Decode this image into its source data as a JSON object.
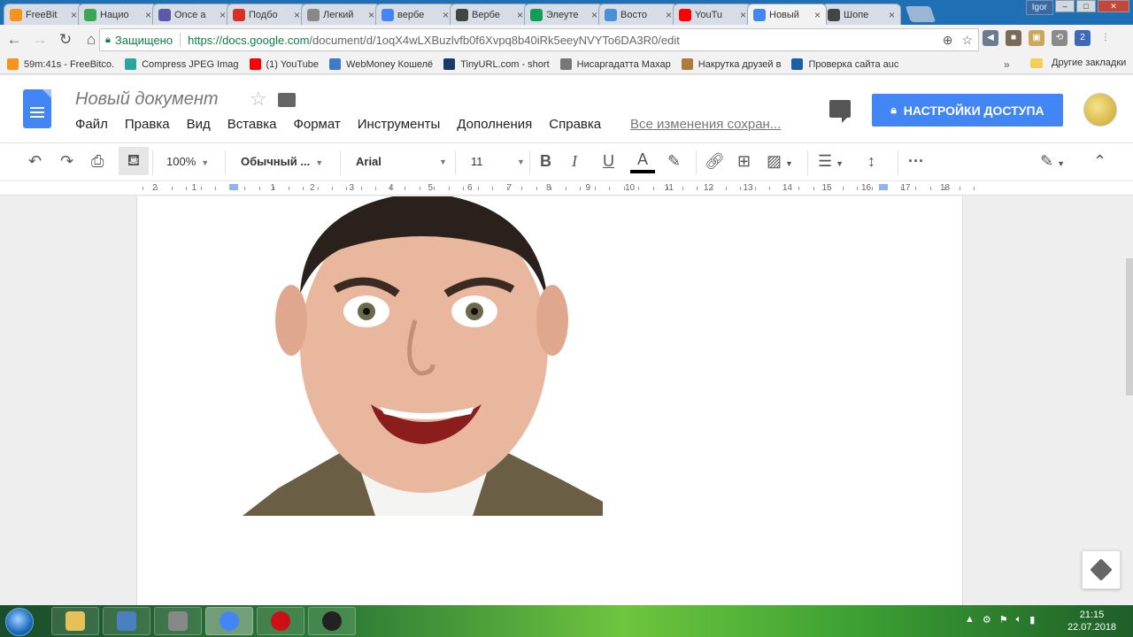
{
  "browser": {
    "tabs": [
      {
        "label": "FreeBit",
        "color": "#f7931a"
      },
      {
        "label": "Нацио",
        "color": "#3aa757"
      },
      {
        "label": "Once a",
        "color": "#5a5aa8"
      },
      {
        "label": "Подбо",
        "color": "#d93025"
      },
      {
        "label": "Легкий",
        "color": "#888888"
      },
      {
        "label": "вербе",
        "color": "#4285f4"
      },
      {
        "label": "Вербе",
        "color": "#444444"
      },
      {
        "label": "Элеуте",
        "color": "#0f9d58"
      },
      {
        "label": "Восто",
        "color": "#4a90d9"
      },
      {
        "label": "YouTu",
        "color": "#ff0000"
      },
      {
        "label": "Новый",
        "color": "#4285f4"
      },
      {
        "label": "Шопе",
        "color": "#444444"
      }
    ],
    "active_tab_index": 10,
    "user_name": "Igor",
    "omnibox": {
      "secure_label": "Защищено",
      "url_host": "https://docs.google.com",
      "url_path": "/document/d/1oqX4wLXBuzlvfb0f6Xvpq8b40iRk5eeyNVYTo6DA3R0/edit"
    },
    "bookmarks": [
      {
        "label": "59m:41s - FreeBitco.",
        "color": "#f7931a"
      },
      {
        "label": "Compress JPEG Imag",
        "color": "#2aa5a0"
      },
      {
        "label": "(1) YouTube",
        "color": "#ff0000"
      },
      {
        "label": "WebMoney Кошелё",
        "color": "#3d7ac7"
      },
      {
        "label": "TinyURL.com - short",
        "color": "#1a3a6b"
      },
      {
        "label": "Нисаргадатта Махар",
        "color": "#777777"
      },
      {
        "label": "Накрутка друзей в",
        "color": "#b07a3a"
      },
      {
        "label": "Проверка сайта аuc",
        "color": "#1d5ea8"
      }
    ],
    "bookmarks_more": "»",
    "other_bookmarks": "Другие закладки"
  },
  "docs": {
    "title": "Новый документ",
    "menu": [
      "Файл",
      "Правка",
      "Вид",
      "Вставка",
      "Формат",
      "Инструменты",
      "Дополнения",
      "Справка"
    ],
    "saved_status": "Все изменения сохран...",
    "share_label": "НАСТРОЙКИ ДОСТУПА",
    "toolbar": {
      "zoom": "100%",
      "style": "Обычный ...",
      "font": "Arial",
      "size": "11",
      "bold": "B",
      "italic": "I",
      "underline": "U",
      "text_color": "A",
      "more": "···"
    },
    "ruler_numbers": [
      "2",
      "1",
      "1",
      "1",
      "2",
      "3",
      "4",
      "5",
      "6",
      "7",
      "8",
      "9",
      "10",
      "11",
      "12",
      "13",
      "14",
      "15",
      "16",
      "17",
      "18"
    ],
    "ruler_ticks": 58,
    "ruler_left_indent_cm": 0,
    "ruler_right_indent_cm": 16.5
  },
  "colors": {
    "docs_blue": "#4285f4",
    "secure_green": "#0b8043"
  },
  "taskbar": {
    "items": [
      {
        "name": "explorer",
        "color": "#e6c15a"
      },
      {
        "name": "computer",
        "color": "#4a7fc0"
      },
      {
        "name": "camera",
        "color": "#888888"
      },
      {
        "name": "chrome",
        "color": "#4285f4"
      },
      {
        "name": "opera",
        "color": "#cc0f16"
      },
      {
        "name": "recorder",
        "color": "#222222"
      }
    ],
    "active_index": 3,
    "time": "21:15",
    "date": "22.07.2018"
  }
}
